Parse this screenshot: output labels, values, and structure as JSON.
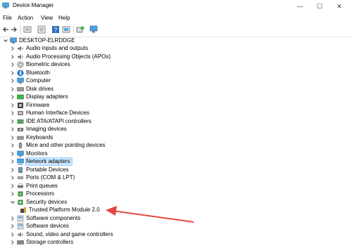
{
  "window": {
    "title": "Device Manager"
  },
  "menu": [
    "File",
    "Action",
    "View",
    "Help"
  ],
  "tree": {
    "root": "DESKTOP-ELRDDGE",
    "items": [
      {
        "label": "Audio inputs and outputs",
        "icon": "speaker-icon",
        "expanded": false
      },
      {
        "label": "Audio Processing Objects (APOs)",
        "icon": "speaker-icon",
        "expanded": false
      },
      {
        "label": "Biometric devices",
        "icon": "fingerprint-icon",
        "expanded": false
      },
      {
        "label": "Bluetooth",
        "icon": "bluetooth-icon",
        "expanded": false
      },
      {
        "label": "Computer",
        "icon": "monitor-icon",
        "expanded": false
      },
      {
        "label": "Disk drives",
        "icon": "disk-icon",
        "expanded": false
      },
      {
        "label": "Display adapters",
        "icon": "display-adapter-icon",
        "expanded": false
      },
      {
        "label": "Firmware",
        "icon": "firmware-icon",
        "expanded": false
      },
      {
        "label": "Human Interface Devices",
        "icon": "hid-icon",
        "expanded": false
      },
      {
        "label": "IDE ATA/ATAPI controllers",
        "icon": "ide-icon",
        "expanded": false
      },
      {
        "label": "Imaging devices",
        "icon": "camera-icon",
        "expanded": false
      },
      {
        "label": "Keyboards",
        "icon": "keyboard-icon",
        "expanded": false
      },
      {
        "label": "Mice and other pointing devices",
        "icon": "mouse-icon",
        "expanded": false
      },
      {
        "label": "Monitors",
        "icon": "monitor-icon",
        "expanded": false
      },
      {
        "label": "Network adapters",
        "icon": "network-icon",
        "expanded": false,
        "selected": true
      },
      {
        "label": "Portable Devices",
        "icon": "portable-icon",
        "expanded": false
      },
      {
        "label": "Ports (COM & LPT)",
        "icon": "port-icon",
        "expanded": false
      },
      {
        "label": "Print queues",
        "icon": "printer-icon",
        "expanded": false
      },
      {
        "label": "Processors",
        "icon": "processor-icon",
        "expanded": false
      },
      {
        "label": "Security devices",
        "icon": "security-icon",
        "expanded": true
      },
      {
        "label": "Trusted Platform Module 2.0",
        "icon": "tpm-icon",
        "child": true
      },
      {
        "label": "Software components",
        "icon": "software-icon",
        "expanded": false
      },
      {
        "label": "Software devices",
        "icon": "software-icon",
        "expanded": false
      },
      {
        "label": "Sound, video and game controllers",
        "icon": "speaker-icon",
        "expanded": false
      },
      {
        "label": "Storage controllers",
        "icon": "storage-icon",
        "expanded": false
      }
    ]
  },
  "colors": {
    "selection": "#cce8ff",
    "arrow": "#e2483f"
  }
}
